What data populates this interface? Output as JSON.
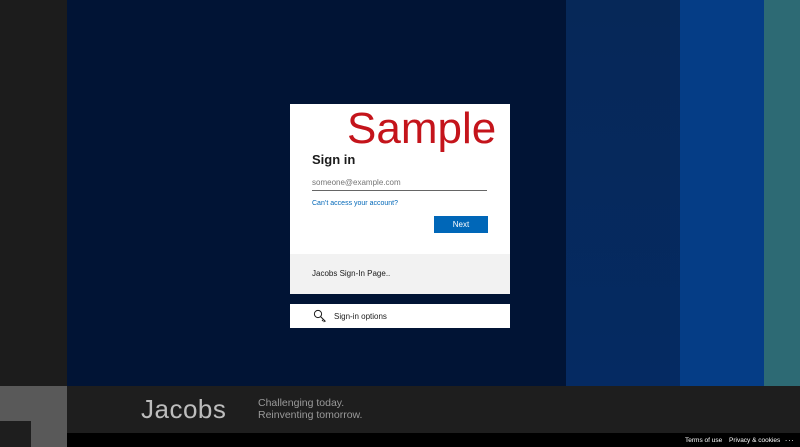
{
  "watermark": "Sample",
  "signin": {
    "title": "Sign in",
    "email_placeholder": "someone@example.com",
    "cant_access": "Can’t access your account?",
    "next_label": "Next",
    "footer_text": "Jacobs Sign-In Page.."
  },
  "options": {
    "label": "Sign-in options",
    "icon": "key-icon"
  },
  "brand": {
    "name": "Jacobs",
    "tagline_line1": "Challenging today.",
    "tagline_line2": "Reinventing tomorrow."
  },
  "footer": {
    "terms": "Terms of use",
    "privacy": "Privacy & cookies",
    "more": "..."
  },
  "colors": {
    "accent": "#0067b8",
    "watermark": "#c4141b",
    "background": "#011435"
  }
}
